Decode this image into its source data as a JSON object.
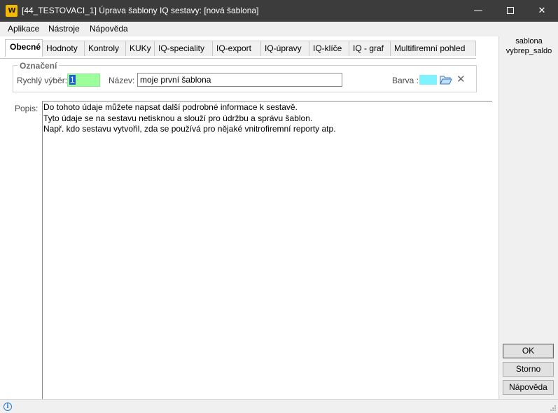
{
  "window": {
    "app_icon": "W",
    "title": "[44_TESTOVACI_1] Úprava šablony IQ sestavy: [nová šablona]",
    "minimize_icon": "minimize-icon",
    "maximize_icon": "maximize-icon",
    "close_icon": "close-icon"
  },
  "menu": {
    "items": [
      "Aplikace",
      "Nástroje",
      "Nápověda"
    ]
  },
  "tabs": [
    {
      "label": "Obecné",
      "active": true
    },
    {
      "label": "Hodnoty"
    },
    {
      "label": "Kontroly"
    },
    {
      "label": "KUKy"
    },
    {
      "label": "IQ-speciality"
    },
    {
      "label": "IQ-export"
    },
    {
      "label": "IQ-úpravy"
    },
    {
      "label": "IQ-klíče"
    },
    {
      "label": "IQ - graf"
    },
    {
      "label": "Multifiremní pohled"
    }
  ],
  "designation": {
    "legend": "Označení",
    "quick_label": "Rychlý výběr:",
    "quick_value": "1",
    "name_label": "Název:",
    "name_value": "moje první šablona",
    "color_label": "Barva :",
    "color_value": "#7ff2ff"
  },
  "description": {
    "label": "Popis:",
    "lines": [
      "Do tohoto údaje můžete napsat další podrobné informace k sestavě.",
      "Tyto údaje se na sestavu netisknou a slouží pro údržbu a správu šablon.",
      "Např. kdo sestavu vytvořil, zda se používá pro nějaké vnitrofiremní reporty atp."
    ]
  },
  "sidebar": {
    "line1": "sablona",
    "line2": "vybrep_saldo",
    "ok": "OK",
    "cancel": "Storno",
    "help": "Nápověda"
  },
  "status": {
    "icon": "info-icon"
  }
}
